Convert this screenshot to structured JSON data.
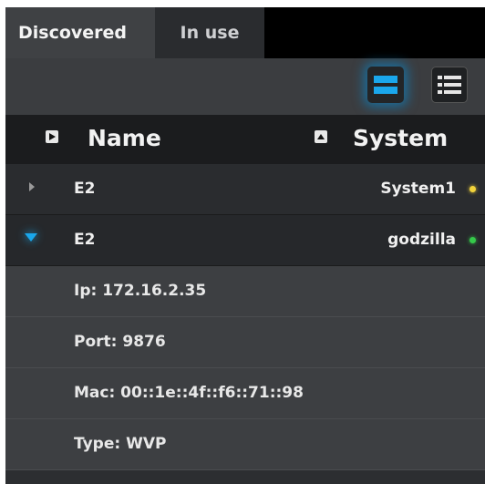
{
  "tabs": [
    {
      "label": "Discovered",
      "active": true
    },
    {
      "label": "In use",
      "active": false
    }
  ],
  "toolbar": {
    "compact_view": {
      "icon": "compact-view-icon",
      "active": true,
      "color": "#1aa7ec"
    },
    "list_view": {
      "icon": "list-view-icon",
      "active": false
    }
  },
  "columns": {
    "name": {
      "label": "Name",
      "sort_icon": "sort-right-icon"
    },
    "system": {
      "label": "System",
      "sort_icon": "sort-up-icon"
    }
  },
  "rows": [
    {
      "name": "E2",
      "system": "System1",
      "status_color": "#f2d33b",
      "expanded": false
    },
    {
      "name": "E2",
      "system": "godzilla",
      "status_color": "#35c94a",
      "expanded": true
    }
  ],
  "details": [
    {
      "text": "Ip: 172.16.2.35"
    },
    {
      "text": "Port: 9876"
    },
    {
      "text": "Mac: 00::1e::4f::f6::71::98"
    },
    {
      "text": "Type: WVP"
    }
  ]
}
